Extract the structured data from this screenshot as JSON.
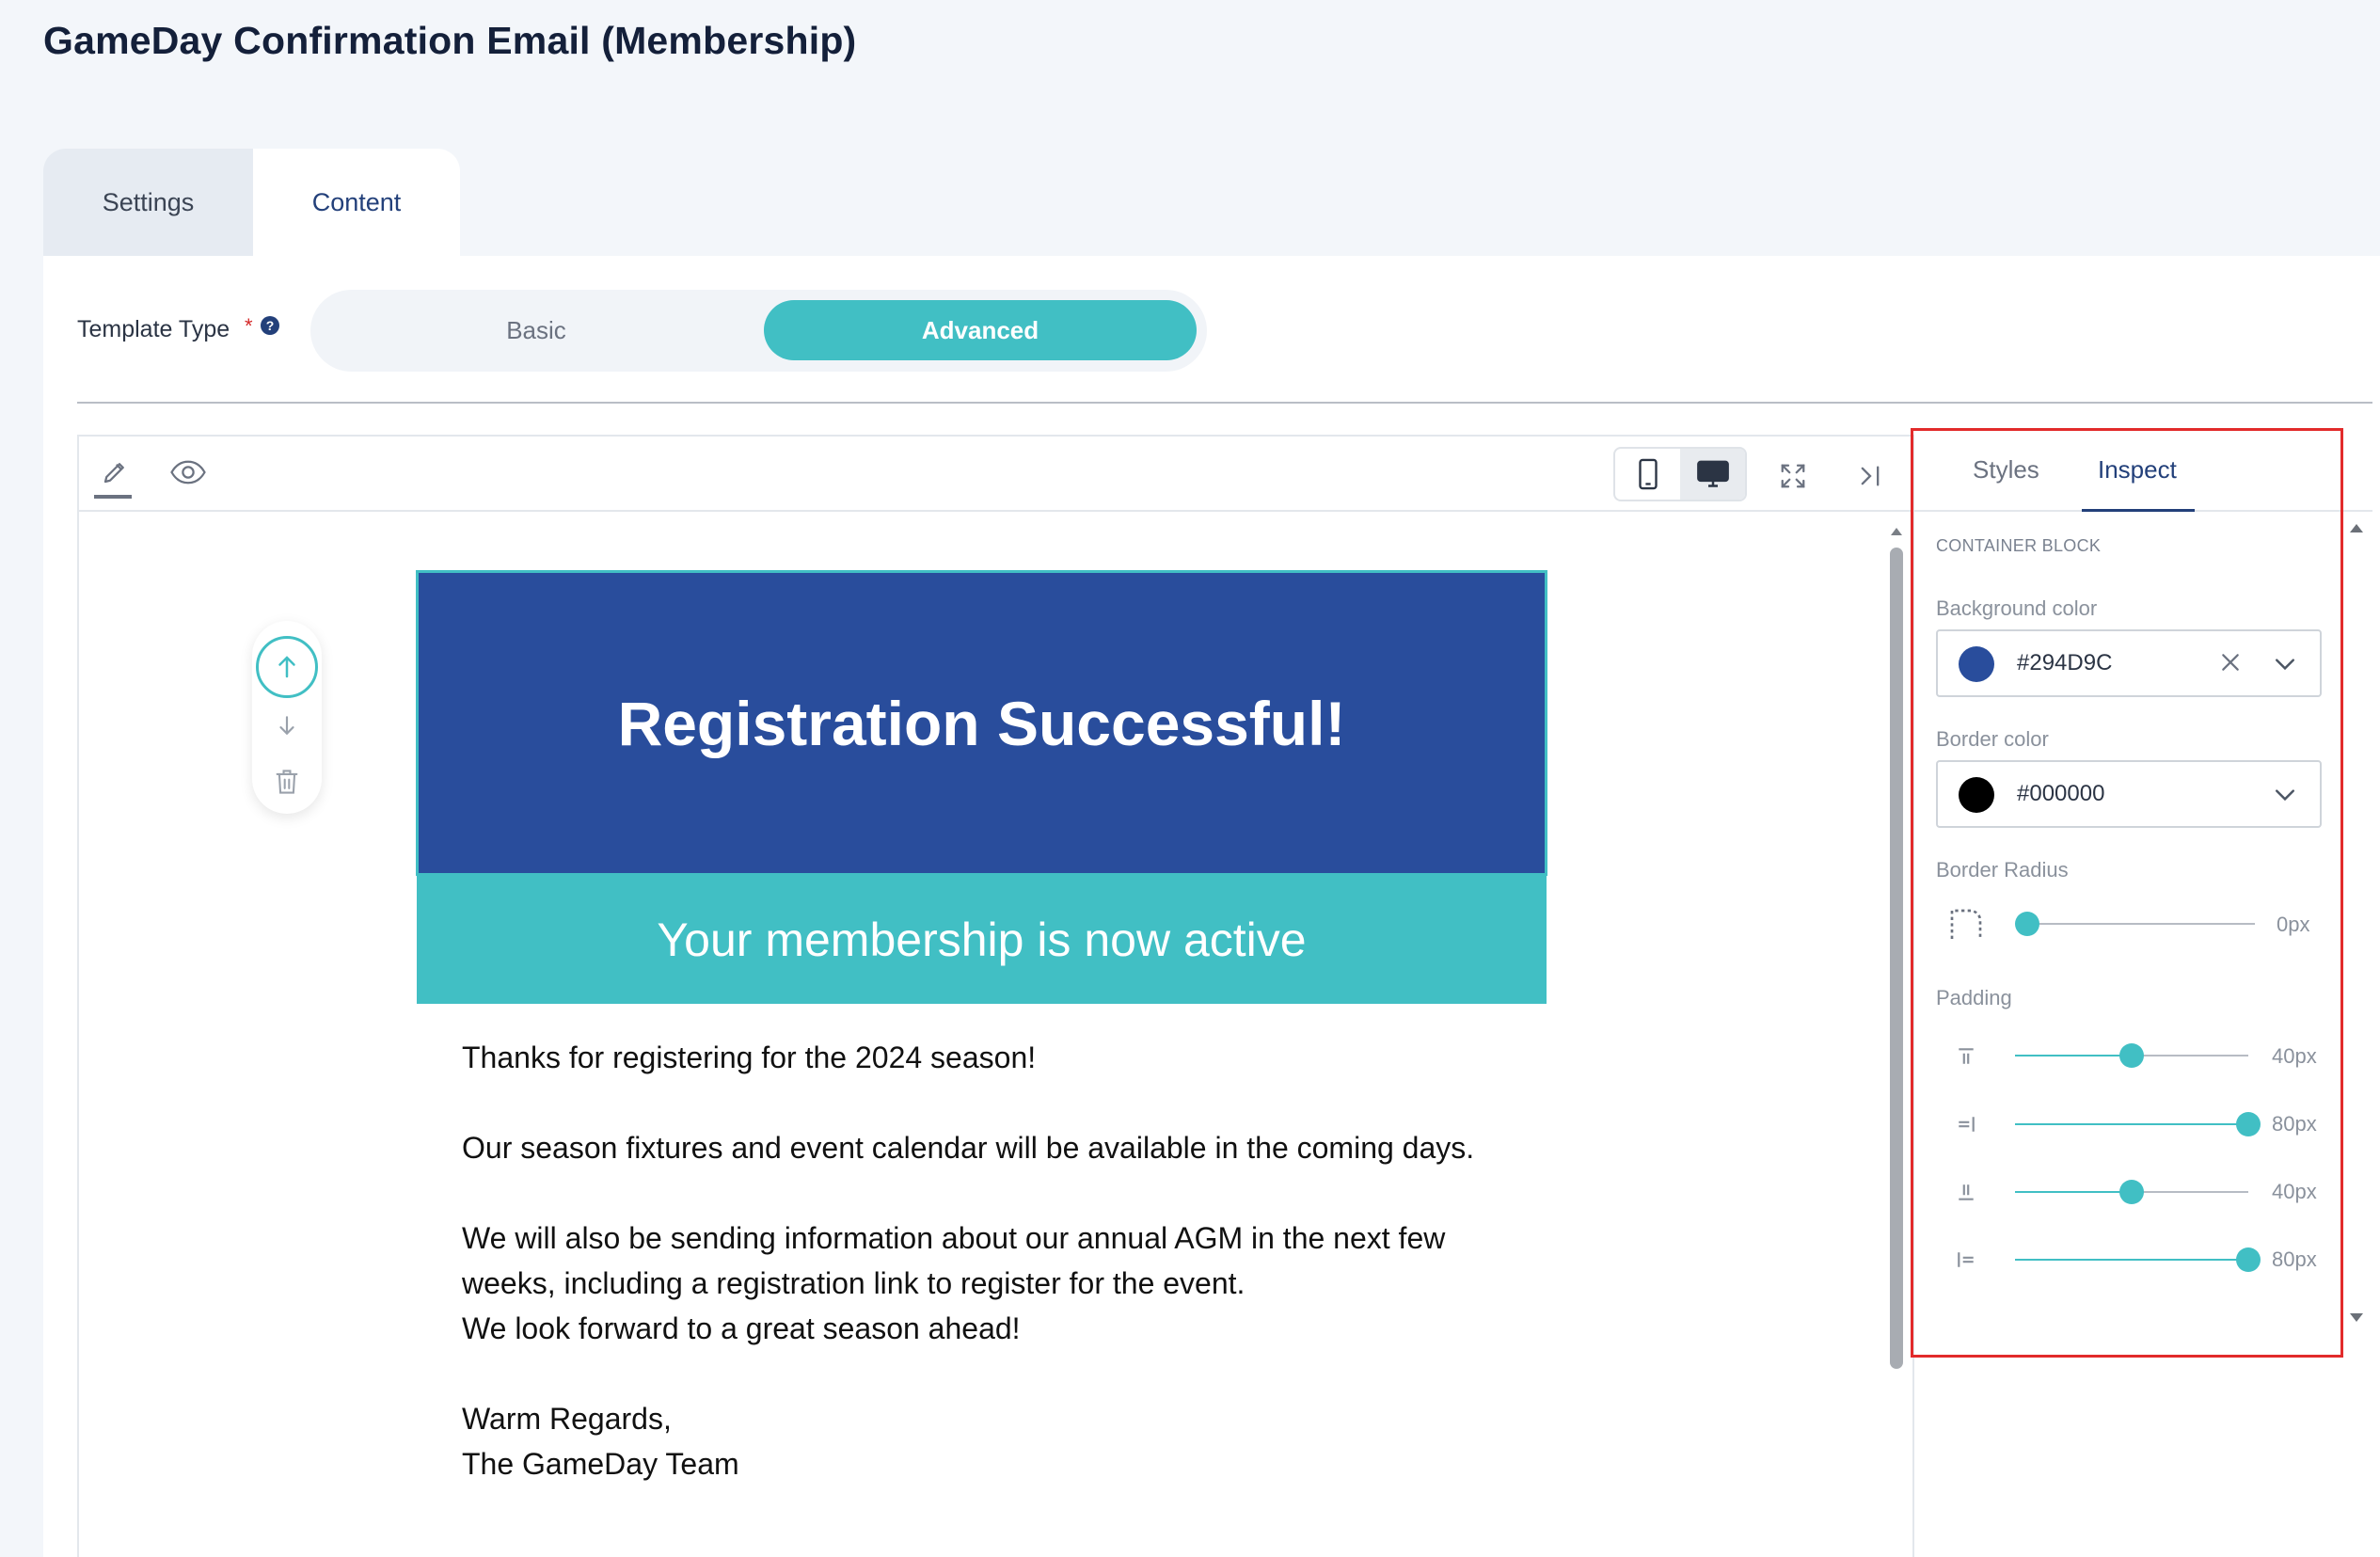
{
  "page": {
    "title": "GameDay Confirmation Email (Membership)"
  },
  "tabs": [
    {
      "label": "Settings",
      "active": false
    },
    {
      "label": "Content",
      "active": true
    }
  ],
  "template_type": {
    "label": "Template Type",
    "required_mark": "*",
    "help_icon": "help-icon",
    "options": [
      "Basic",
      "Advanced"
    ],
    "selected": "Advanced"
  },
  "toolbar": {
    "icons": [
      "pencil-icon",
      "eye-icon",
      "mobile-icon",
      "desktop-icon",
      "fullscreen-icon",
      "collapse-panel-icon"
    ],
    "active_device": "desktop"
  },
  "email": {
    "hero_title": "Registration Successful!",
    "hero_color": "#294D9C",
    "banner_text": "Your membership is now active",
    "banner_color": "#41BFC4",
    "paragraphs": [
      "Thanks for registering for the 2024 season!",
      "Our season fixtures and event calendar will be available in the coming days.",
      "We will also be sending information about our annual AGM in the next few",
      "weeks, including a registration link to register for the event.",
      "We look forward to a great season ahead!",
      "Warm Regards,",
      "The GameDay Team"
    ]
  },
  "panel": {
    "tabs": [
      "Styles",
      "Inspect"
    ],
    "active_tab": "Inspect",
    "section": "CONTAINER BLOCK",
    "background": {
      "label": "Background color",
      "value": "#294D9C",
      "swatch": "#294D9C"
    },
    "border": {
      "label": "Border color",
      "value": "#000000",
      "swatch": "#000000"
    },
    "radius": {
      "label": "Border Radius",
      "value": "0px",
      "fraction": 0.0
    },
    "padding": {
      "label": "Padding",
      "top": {
        "value": "40px",
        "fraction": 0.5
      },
      "right": {
        "value": "80px",
        "fraction": 1.0
      },
      "bottom": {
        "value": "40px",
        "fraction": 0.5
      },
      "left": {
        "value": "80px",
        "fraction": 1.0
      }
    }
  }
}
